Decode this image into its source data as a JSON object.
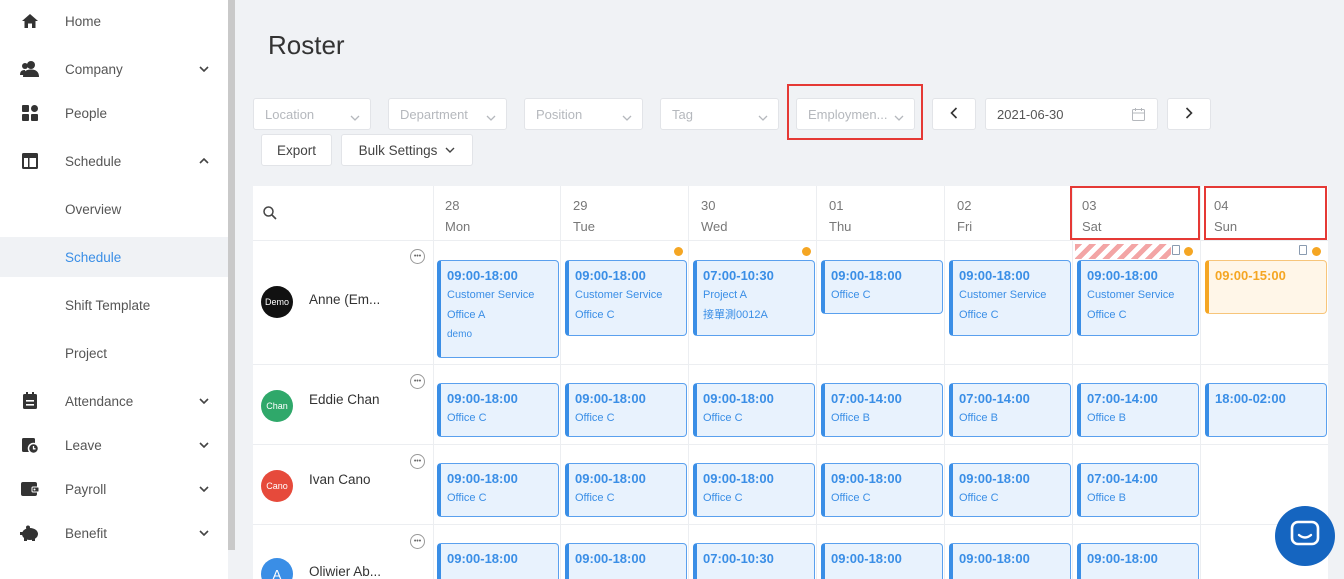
{
  "sidebar": {
    "items": [
      {
        "label": "Home",
        "icon": "home-icon"
      },
      {
        "label": "Company",
        "icon": "company-icon",
        "expand": "chevron-down"
      },
      {
        "label": "People",
        "icon": "people-icon"
      },
      {
        "label": "Schedule",
        "icon": "schedule-icon",
        "expand": "chevron-up"
      },
      {
        "label": "Overview"
      },
      {
        "label": "Schedule",
        "active": true
      },
      {
        "label": "Shift Template"
      },
      {
        "label": "Project"
      },
      {
        "label": "Attendance",
        "icon": "attendance-icon",
        "expand": "chevron-down"
      },
      {
        "label": "Leave",
        "icon": "leave-icon",
        "expand": "chevron-down"
      },
      {
        "label": "Payroll",
        "icon": "payroll-icon",
        "expand": "chevron-down"
      },
      {
        "label": "Benefit",
        "icon": "benefit-icon",
        "expand": "chevron-down"
      }
    ]
  },
  "page": {
    "title": "Roster"
  },
  "filters": {
    "location": "Location",
    "department": "Department",
    "position": "Position",
    "tag": "Tag",
    "employment": "Employmen...",
    "date": "2021-06-30"
  },
  "actions": {
    "export": "Export",
    "bulk_settings": "Bulk Settings"
  },
  "days": [
    {
      "num": "28",
      "name": "Mon"
    },
    {
      "num": "29",
      "name": "Tue"
    },
    {
      "num": "30",
      "name": "Wed"
    },
    {
      "num": "01",
      "name": "Thu"
    },
    {
      "num": "02",
      "name": "Fri"
    },
    {
      "num": "03",
      "name": "Sat"
    },
    {
      "num": "04",
      "name": "Sun"
    }
  ],
  "employees": [
    {
      "name": "Anne (Em...",
      "avatar_text": "Demo",
      "avatar_color": "#111111",
      "shifts": [
        {
          "time": "09:00-18:00",
          "lines": [
            "Customer Service",
            "Office A",
            "demo"
          ]
        },
        {
          "time": "09:00-18:00",
          "lines": [
            "Customer Service",
            "Office C"
          ]
        },
        {
          "time": "07:00-10:30",
          "lines": [
            "Project A",
            "接單測0012A"
          ]
        },
        {
          "time": "09:00-18:00",
          "lines": [
            "Office C"
          ]
        },
        {
          "time": "09:00-18:00",
          "lines": [
            "Customer Service",
            "Office C"
          ]
        },
        {
          "time": "09:00-18:00",
          "lines": [
            "Customer Service",
            "Office C"
          ]
        },
        {
          "time": "09:00-15:00",
          "lines": [],
          "style": "orange"
        }
      ]
    },
    {
      "name": "Eddie Chan",
      "avatar_text": "Chan",
      "avatar_color": "#2fa86a",
      "shifts": [
        {
          "time": "09:00-18:00",
          "lines": [
            "Office C"
          ]
        },
        {
          "time": "09:00-18:00",
          "lines": [
            "Office C"
          ]
        },
        {
          "time": "09:00-18:00",
          "lines": [
            "Office C"
          ]
        },
        {
          "time": "07:00-14:00",
          "lines": [
            "Office B"
          ]
        },
        {
          "time": "07:00-14:00",
          "lines": [
            "Office B"
          ]
        },
        {
          "time": "07:00-14:00",
          "lines": [
            "Office B"
          ]
        },
        {
          "time": "18:00-02:00",
          "lines": []
        }
      ]
    },
    {
      "name": "Ivan Cano",
      "avatar_text": "Cano",
      "avatar_color": "#e64a3b",
      "shifts": [
        {
          "time": "09:00-18:00",
          "lines": [
            "Office C"
          ]
        },
        {
          "time": "09:00-18:00",
          "lines": [
            "Office C"
          ]
        },
        {
          "time": "09:00-18:00",
          "lines": [
            "Office C"
          ]
        },
        {
          "time": "09:00-18:00",
          "lines": [
            "Office C"
          ]
        },
        {
          "time": "09:00-18:00",
          "lines": [
            "Office C"
          ]
        },
        {
          "time": "07:00-14:00",
          "lines": [
            "Office B"
          ]
        }
      ]
    },
    {
      "name": "Oliwier Ab...",
      "avatar_text": "A",
      "avatar_color": "#3a8ee6",
      "shifts": [
        {
          "time": "09:00-18:00",
          "lines": []
        },
        {
          "time": "09:00-18:00",
          "lines": []
        },
        {
          "time": "07:00-10:30",
          "lines": []
        },
        {
          "time": "09:00-18:00",
          "lines": []
        },
        {
          "time": "09:00-18:00",
          "lines": []
        },
        {
          "time": "09:00-18:00",
          "lines": []
        }
      ]
    }
  ],
  "colors": {
    "accent": "#3a8ee6",
    "warning": "#f5a623",
    "highlight": "#e53935"
  }
}
